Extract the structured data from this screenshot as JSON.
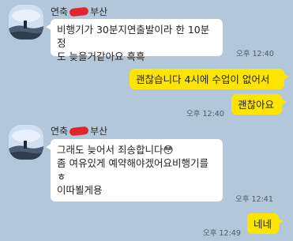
{
  "messages": [
    {
      "sender_prefix": "연축",
      "sender_suffix": "부산",
      "text": "비행기가 30분지연출발이라 한 10분정\n도 늦을거같아요 흑흑",
      "time": "오후 12:40"
    },
    {
      "text": "괜찮습니다 4시에 수업이 없어서"
    },
    {
      "text": "괜찮아요",
      "time": "오후 12:40"
    },
    {
      "sender_prefix": "연축",
      "sender_suffix": "부산",
      "text": "그래도 늦어서 죄송합니다😳\n좀 여유있게 예약해야겠어요비행기를\nㅎ\n이따뵐게용",
      "time": "오후 12:41"
    },
    {
      "text": "네네",
      "time": "오후 12:49"
    }
  ],
  "colors": {
    "background": "#b2c7da",
    "incoming_bubble": "#ffffff",
    "outgoing_bubble": "#fee500"
  }
}
